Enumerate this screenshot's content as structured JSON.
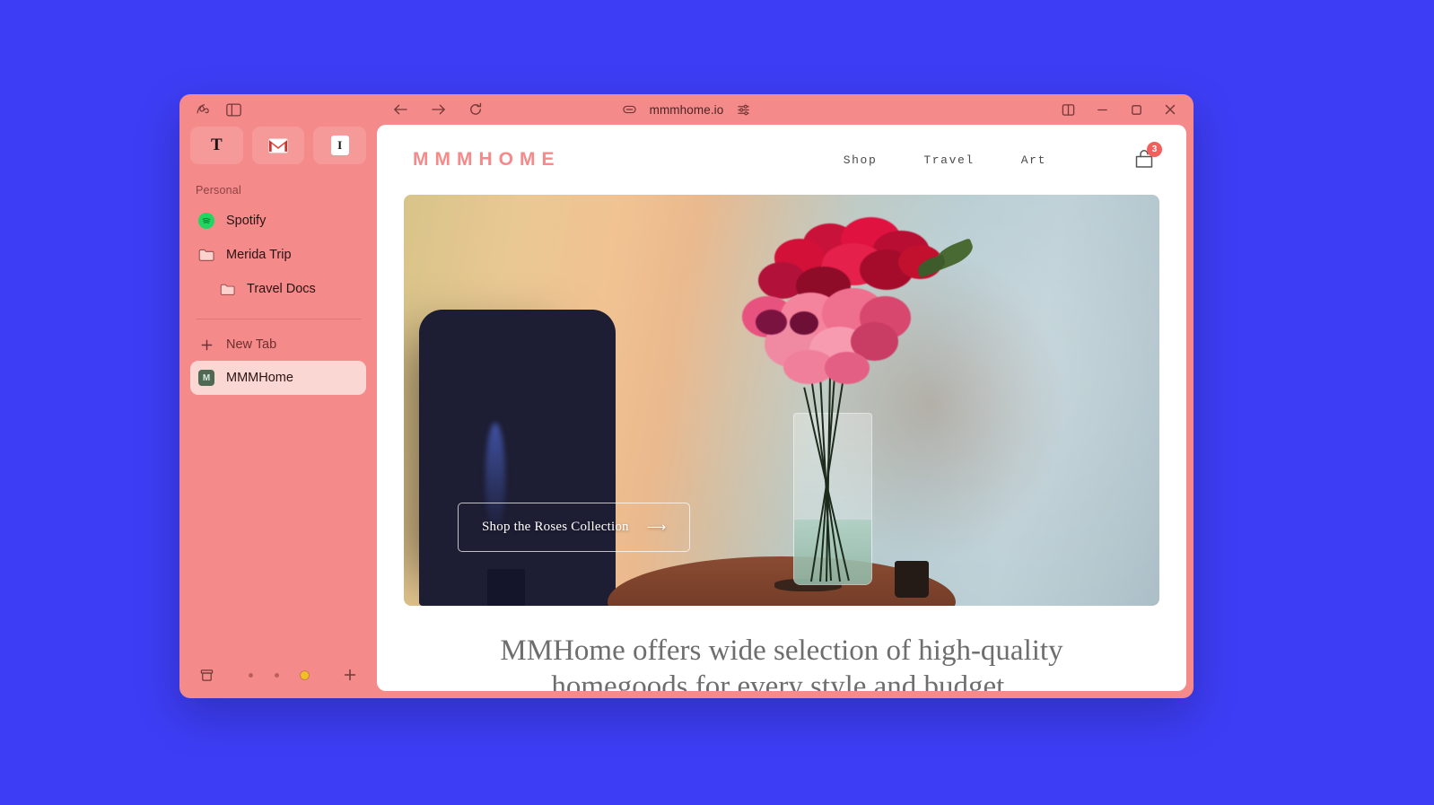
{
  "desktop": {
    "background_color": "#3d3df5"
  },
  "browser": {
    "accent_color": "#f58a8a",
    "toolbar": {
      "arc_logo_icon": "arc-logo-icon",
      "sidebar_toggle_icon": "sidebar-toggle-icon",
      "back_icon": "back-arrow-icon",
      "forward_icon": "forward-arrow-icon",
      "reload_icon": "reload-icon",
      "link_icon": "link-icon",
      "url": "mmmhome.io",
      "settings_icon": "sliders-icon",
      "split_view_icon": "split-view-icon",
      "minimize_icon": "minimize-icon",
      "maximize_icon": "maximize-icon",
      "close_icon": "close-icon"
    },
    "sidebar": {
      "pinned": [
        {
          "name": "nyt",
          "glyph": "T",
          "label": "New York Times"
        },
        {
          "name": "gmail",
          "glyph": "M",
          "label": "Gmail"
        },
        {
          "name": "instapaper",
          "glyph": "I",
          "label": "Instapaper"
        }
      ],
      "section_label": "Personal",
      "items": [
        {
          "label": "Spotify",
          "icon": "spotify-icon",
          "indent": false,
          "active": false
        },
        {
          "label": "Merida Trip",
          "icon": "folder-icon",
          "indent": false,
          "active": false
        },
        {
          "label": "Travel Docs",
          "icon": "folder-icon",
          "indent": true,
          "active": false
        }
      ],
      "new_tab_label": "New Tab",
      "tabs": [
        {
          "label": "MMMHome",
          "favicon_letter": "M",
          "active": true
        }
      ],
      "bottom": {
        "archive_icon": "archive-icon",
        "plus_icon": "plus-icon",
        "dots": [
          "dot",
          "dot",
          "sun"
        ]
      }
    }
  },
  "site": {
    "brand": "MMMHOME",
    "brand_color": "#f58a8a",
    "nav": [
      {
        "label": "Shop"
      },
      {
        "label": "Travel"
      },
      {
        "label": "Art"
      }
    ],
    "cart": {
      "icon": "shopping-bag-icon",
      "count": "3",
      "badge_color": "#f2605d"
    },
    "hero": {
      "alt": "Red and pink roses in a clear glass vase on a wooden side table beside a dark armchair",
      "cta_label": "Shop the Roses Collection",
      "cta_arrow": "⟶"
    },
    "tagline": "MMHome offers wide selection of high-quality homegoods for every style and budget."
  }
}
